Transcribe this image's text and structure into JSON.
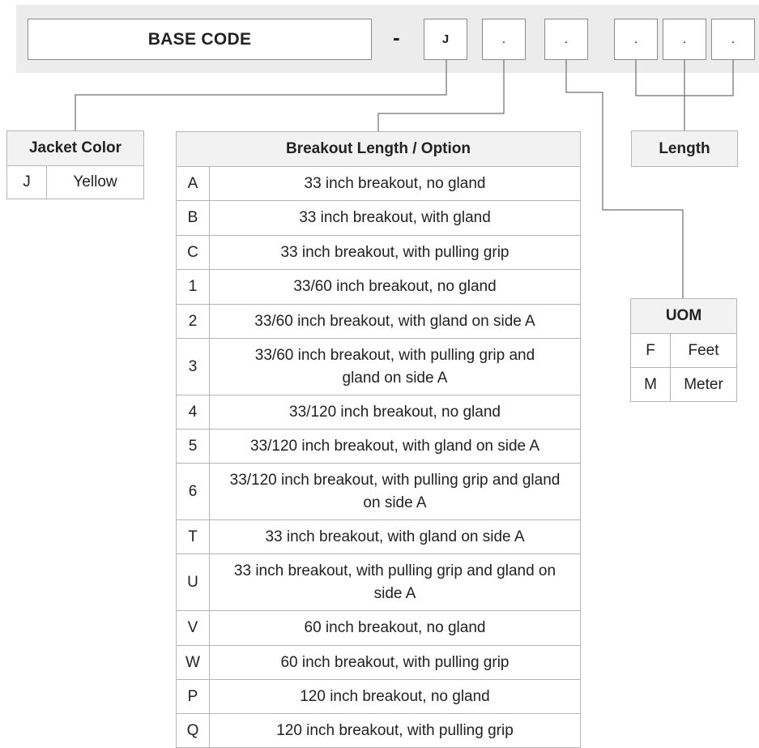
{
  "code_bar": {
    "base_code": "BASE CODE",
    "separator": "-",
    "slots": [
      "J",
      ".",
      ".",
      ".",
      ".",
      "."
    ]
  },
  "jacket_color": {
    "title": "Jacket Color",
    "rows": [
      {
        "code": "J",
        "label": "Yellow"
      }
    ]
  },
  "breakout": {
    "title": "Breakout Length / Option",
    "rows": [
      {
        "code": "A",
        "label": "33 inch breakout, no gland"
      },
      {
        "code": "B",
        "label": "33 inch breakout, with gland"
      },
      {
        "code": "C",
        "label": "33 inch breakout, with pulling grip"
      },
      {
        "code": "1",
        "label": "33/60 inch breakout, no gland"
      },
      {
        "code": "2",
        "label": "33/60 inch breakout, with gland on side A"
      },
      {
        "code": "3",
        "label": "33/60 inch breakout, with pulling grip and gland on side A"
      },
      {
        "code": "4",
        "label": "33/120 inch breakout, no gland"
      },
      {
        "code": "5",
        "label": "33/120 inch breakout, with gland on side A"
      },
      {
        "code": "6",
        "label": "33/120 inch breakout, with pulling grip and gland on side A"
      },
      {
        "code": "T",
        "label": "33 inch breakout, with gland on side A"
      },
      {
        "code": "U",
        "label": "33 inch breakout, with pulling grip and gland on side A"
      },
      {
        "code": "V",
        "label": "60 inch breakout, no gland"
      },
      {
        "code": "W",
        "label": "60 inch breakout, with pulling grip"
      },
      {
        "code": "P",
        "label": "120 inch breakout, no gland"
      },
      {
        "code": "Q",
        "label": "120 inch breakout, with pulling grip"
      }
    ]
  },
  "length": {
    "title": "Length"
  },
  "uom": {
    "title": "UOM",
    "rows": [
      {
        "code": "F",
        "label": "Feet"
      },
      {
        "code": "M",
        "label": "Meter"
      }
    ]
  }
}
